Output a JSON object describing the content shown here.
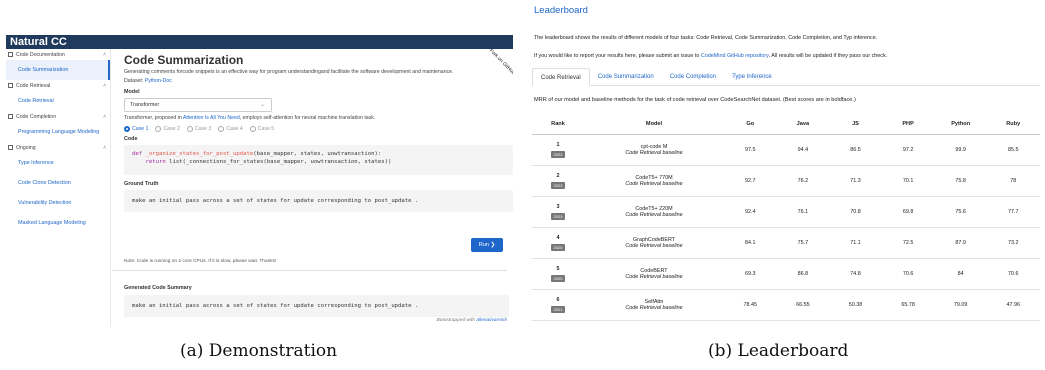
{
  "demo": {
    "brand": "Natural CC",
    "fork_ribbon": "Fork on GitHub",
    "sidebar": [
      {
        "group": "Code Documentation",
        "items": [
          "Code Summarization"
        ]
      },
      {
        "group": "Code Retrieval",
        "items": [
          "Code Retrieval"
        ]
      },
      {
        "group": "Code Completion",
        "items": [
          "Programming Language Modeling"
        ]
      },
      {
        "group": "Ongoing",
        "items": [
          "Type Inference",
          "Code Clone Detection",
          "Vulnerability Detection",
          "Masked Language Modeling"
        ]
      }
    ],
    "title": "Code Summarization",
    "description": "Generating comments forcode snippets is an effective way for program understandingand facilitate the software development and maintenance.",
    "dataset_label": "Dataset:",
    "dataset_value": "Python-Doc",
    "model_label": "Model",
    "model_selected": "Transformer",
    "model_note_pre": "Transformer, proposed in",
    "model_note_link": "Attention Is All You Need",
    "model_note_post": ", employs self-attention for neural machine translation task.",
    "cases": [
      "Case 1",
      "Case 2",
      "Case 3",
      "Case 4",
      "Case 5"
    ],
    "code_label": "Code",
    "code_line1_kw": "def",
    "code_line1_fn": "_organize_states_for_post_update",
    "code_line1_rest": "(base_mapper, states, uowtransaction):",
    "code_line2_kw": "return",
    "code_line2_rest": "list(_connections_for_states(base_mapper, uowtransaction, states))",
    "ground_truth_label": "Ground Truth",
    "ground_truth": "make an initial pass across a set of states for update corresponding to post_update .",
    "run_label": "Run  ❯",
    "run_note": "Note: Code is running on 2 core CPUs. If it is slow, please wait. Thanks!",
    "generated_label": "Generated Code Summary",
    "generated": "make an initial pass across a set of states for update corresponding to post_update .",
    "footer_pre": "Bootstrapped with",
    "footer_link": "allenai/varnish"
  },
  "leaderboard": {
    "title": "Leaderboard",
    "intro": "The leaderboard shows the results of different models of four tasks: Code Retrieval, Code Summarization, Code Completion, and Typ inference.",
    "report_pre": "If you would like to report your results here, please submit an issue to",
    "report_link": "CodeMind GitHub repository",
    "report_post": ". All results will be updated if they pass our check.",
    "tabs": [
      "Code Retrieval",
      "Code Summarization",
      "Code Completion",
      "Type Inference"
    ],
    "caption": "MRR of our model and baseline methods for the task of code retrieval over CodeSearchNet dataset. (Best scores are in boldface.)",
    "columns": [
      "Rank",
      "Model",
      "Go",
      "Java",
      "JS",
      "PHP",
      "Python",
      "Ruby"
    ],
    "rows": [
      {
        "rank": "1",
        "year": "2022",
        "model": "cpt-code M",
        "sub": "Code Retrieval baseline",
        "vals": [
          "97.5",
          "94.4",
          "86.5",
          "97.2",
          "99.9",
          "85.5"
        ]
      },
      {
        "rank": "2",
        "year": "2023",
        "model": "CodeT5+ 770M",
        "sub": "Code Retrieval baseline",
        "vals": [
          "92.7",
          "76.2",
          "71.3",
          "70.1",
          "75.8",
          "78"
        ]
      },
      {
        "rank": "3",
        "year": "2023",
        "model": "CodeT5+ 220M",
        "sub": "Code Retrieval baseline",
        "vals": [
          "92.4",
          "76.1",
          "70.8",
          "69.8",
          "75.6",
          "77.7"
        ]
      },
      {
        "rank": "4",
        "year": "2020",
        "model": "GraphCodeBERT",
        "sub": "Code Retrieval baseline",
        "vals": [
          "84.1",
          "75.7",
          "71.1",
          "72.5",
          "87.9",
          "73.2"
        ]
      },
      {
        "rank": "5",
        "year": "2020",
        "model": "CodeBERT",
        "sub": "Code Retrieval baseline",
        "vals": [
          "69.3",
          "86.8",
          "74.8",
          "70.6",
          "84",
          "70.6"
        ]
      },
      {
        "rank": "6",
        "year": "2021",
        "model": "SelfAttn",
        "sub": "Code Retrieval baseline",
        "vals": [
          "78.45",
          "66.55",
          "50.38",
          "65.78",
          "79.09",
          "47.96"
        ]
      }
    ]
  },
  "captions": {
    "left": "(a) Demonstration",
    "right": "(b) Leaderboard"
  }
}
